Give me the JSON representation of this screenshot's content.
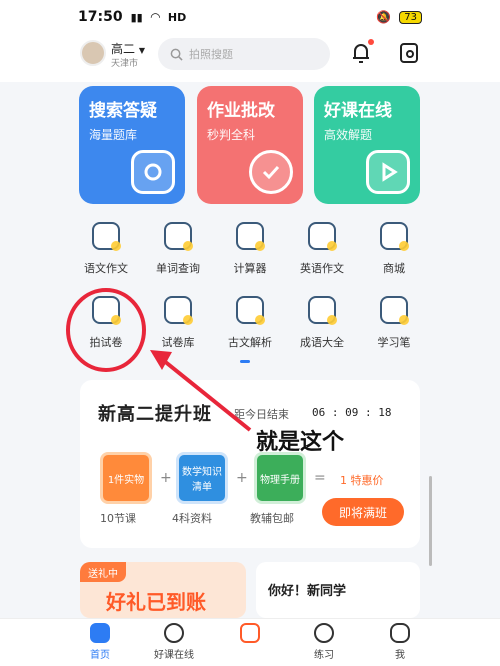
{
  "status": {
    "time": "17:50",
    "network": "HD",
    "battery": "73"
  },
  "header": {
    "grade": "高二",
    "city": "天津市",
    "search_placeholder": "拍照搜题"
  },
  "cards": [
    {
      "title": "搜索答疑",
      "subtitle": "海量题库",
      "icon": "camera-icon",
      "color": "#3d88ee"
    },
    {
      "title": "作业批改",
      "subtitle": "秒判全科",
      "icon": "check-icon",
      "color": "#f47272"
    },
    {
      "title": "好课在线",
      "subtitle": "高效解题",
      "icon": "play-icon",
      "color": "#34cca1"
    }
  ],
  "tools": [
    {
      "label": "语文作文",
      "icon": "book-icon"
    },
    {
      "label": "单词查询",
      "icon": "letter-a-icon"
    },
    {
      "label": "计算器",
      "icon": "calculator-icon"
    },
    {
      "label": "英语作文",
      "icon": "letter-a-book-icon"
    },
    {
      "label": "商城",
      "icon": "shop-icon"
    },
    {
      "label": "拍试卷",
      "icon": "paper-scan-icon"
    },
    {
      "label": "试卷库",
      "icon": "paper-icon"
    },
    {
      "label": "古文解析",
      "icon": "classic-book-icon"
    },
    {
      "label": "成语大全",
      "icon": "idiom-book-icon"
    },
    {
      "label": "学习笔",
      "icon": "pen-icon"
    }
  ],
  "promo": {
    "title": "新高二提升班",
    "countdown_label": "距今日结束",
    "countdown": "06 : 09 : 18",
    "items": [
      {
        "box": "1件实物",
        "label": "10节课"
      },
      {
        "box": "数学知识清单",
        "label": "4科资料"
      },
      {
        "box": "物理手册",
        "label": "教辅包邮"
      }
    ],
    "price": "1 特惠价",
    "cta": "即将满班"
  },
  "gift": {
    "tag": "送礼中",
    "title": "好礼已到账"
  },
  "hello": {
    "title": "你好！新同学"
  },
  "nav": [
    {
      "label": "首页",
      "active": true
    },
    {
      "label": "好课在线",
      "active": false
    },
    {
      "label": "",
      "active": false
    },
    {
      "label": "练习",
      "active": false
    },
    {
      "label": "我",
      "active": false
    }
  ],
  "annotation": {
    "text": "就是这个",
    "color": "#e8263a"
  }
}
